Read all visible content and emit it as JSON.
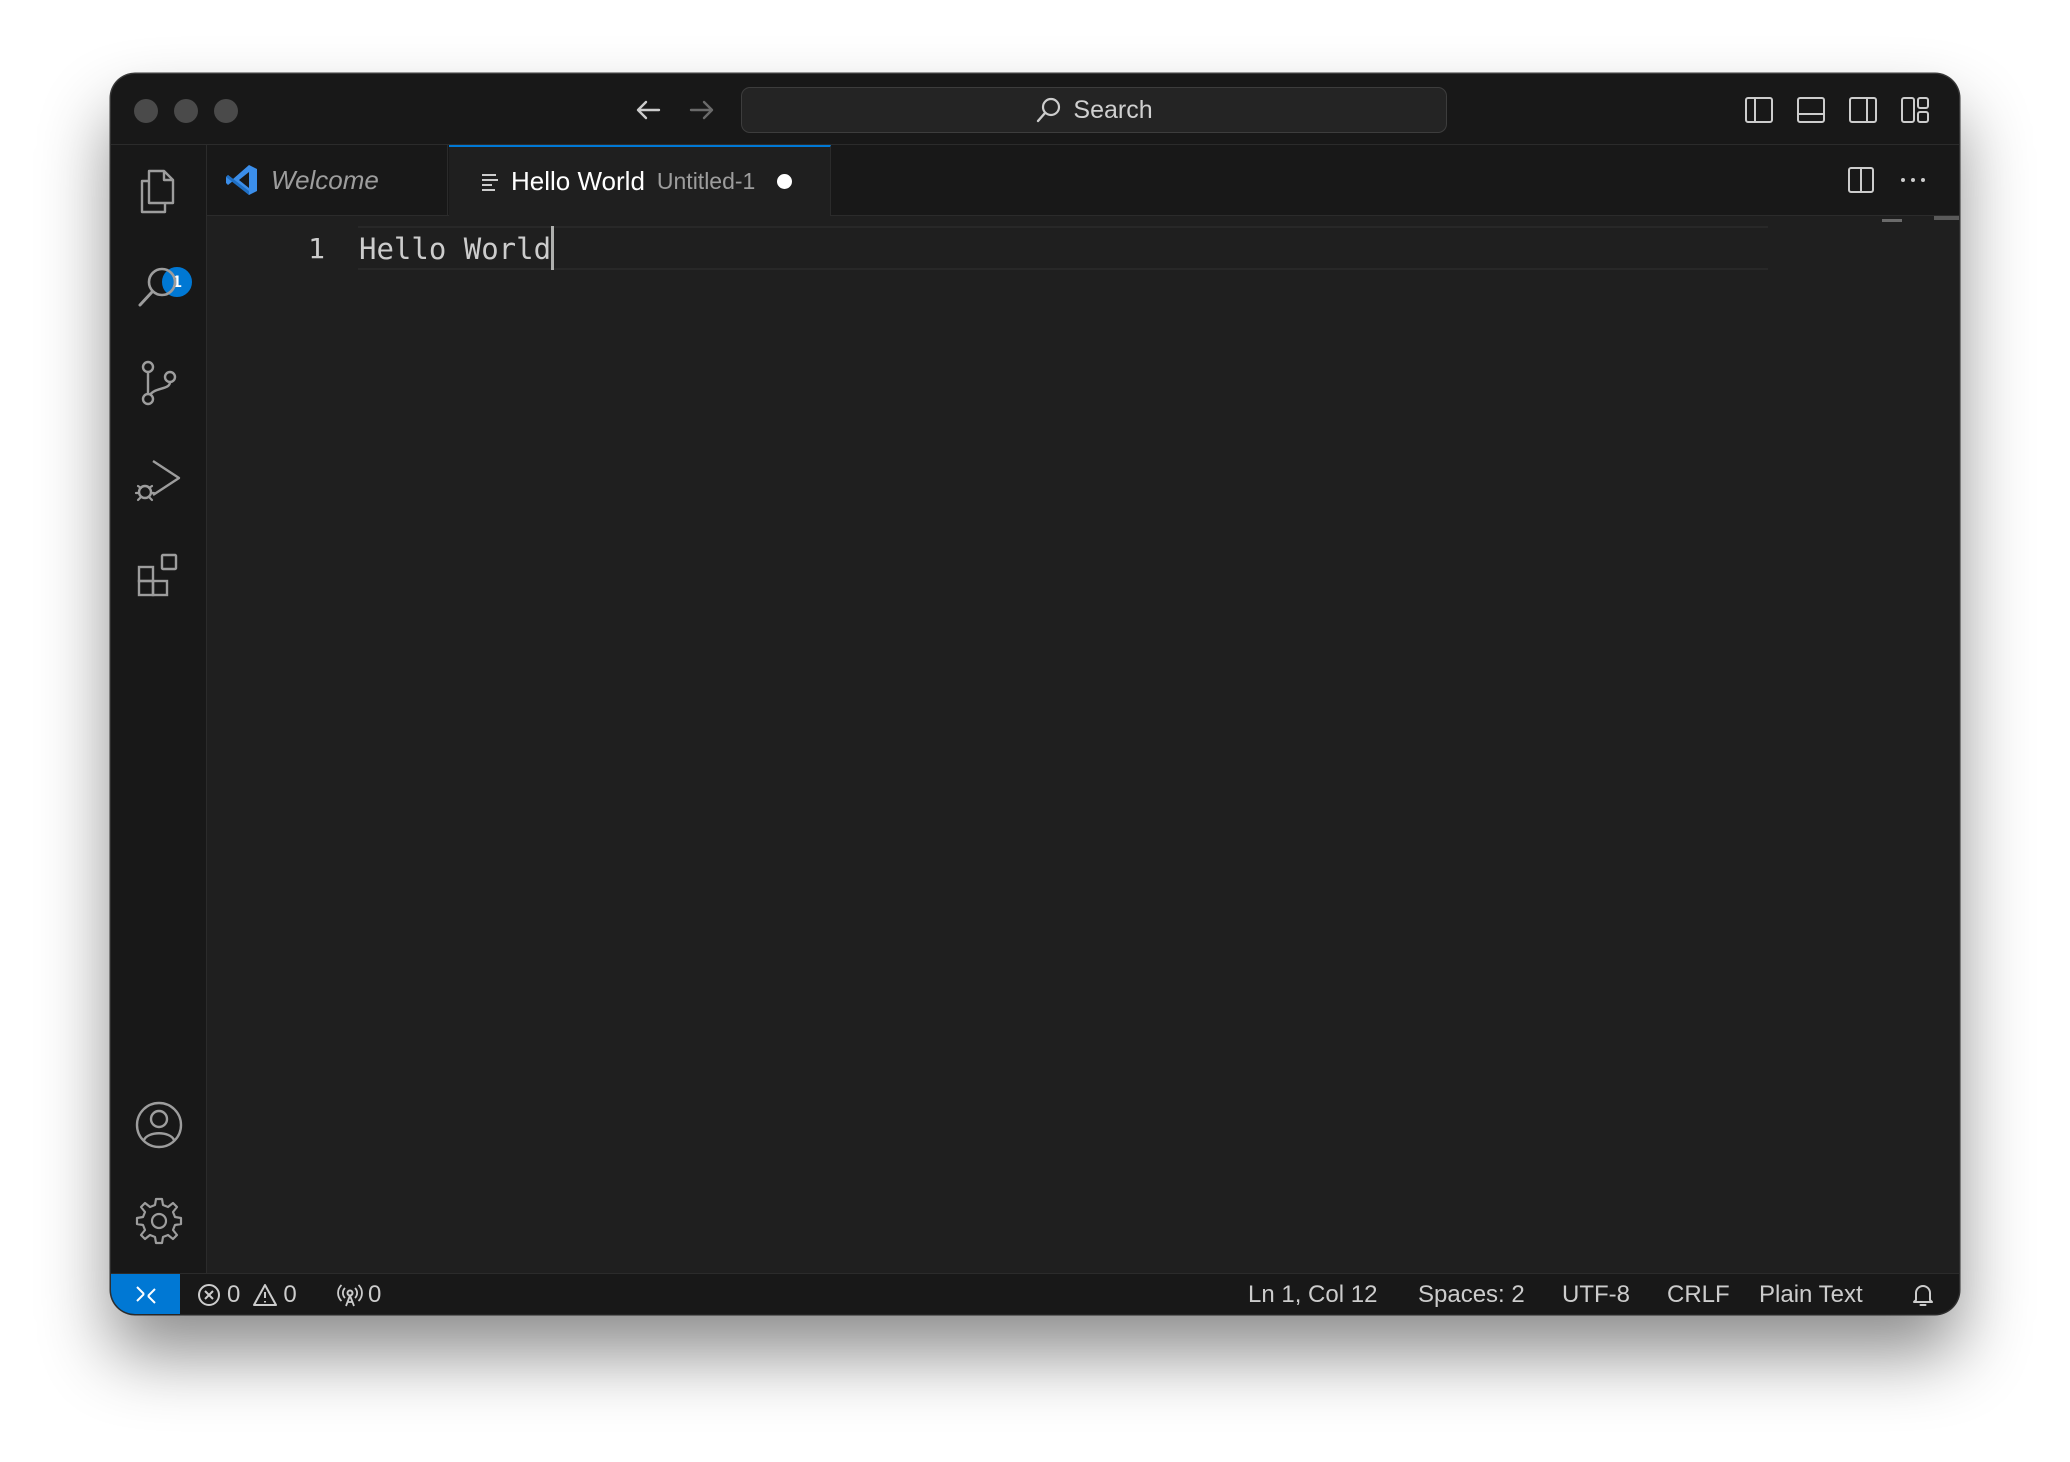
{
  "titlebar": {
    "search_label": "Search"
  },
  "activitybar": {
    "explorer_badge": "1"
  },
  "tabs": [
    {
      "label": "Welcome"
    },
    {
      "label": "Hello World",
      "description": "Untitled-1"
    }
  ],
  "editor": {
    "line_number": "1",
    "content": "Hello World"
  },
  "statusbar": {
    "errors": "0",
    "warnings": "0",
    "ports": "0",
    "position": "Ln 1, Col 12",
    "spaces": "Spaces: 2",
    "encoding": "UTF-8",
    "eol": "CRLF",
    "language": "Plain Text"
  },
  "colors": {
    "accent": "#0078d4",
    "editor_bg": "#1f1f1f",
    "chrome_bg": "#181818"
  }
}
